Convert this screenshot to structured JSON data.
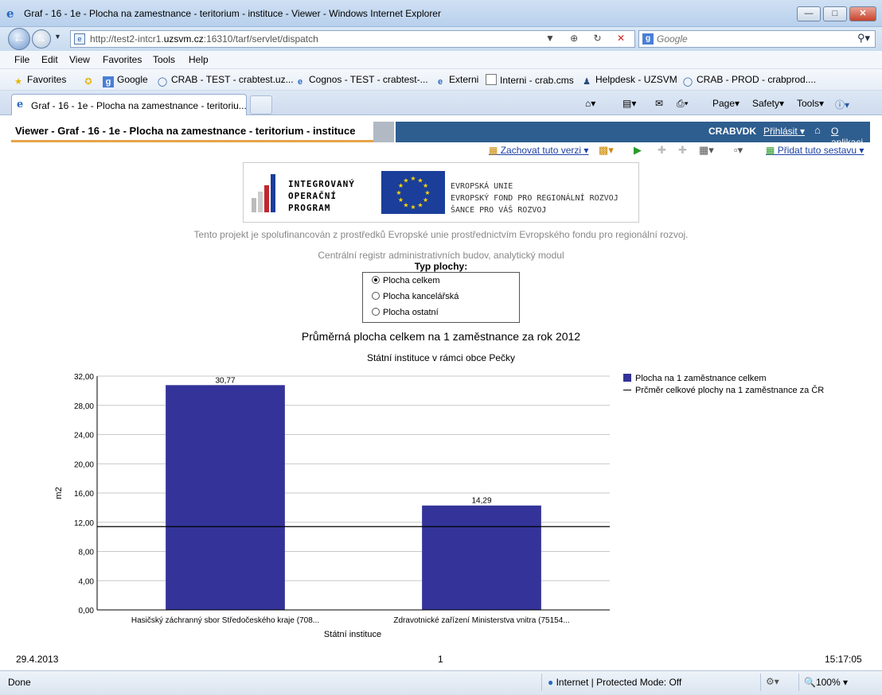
{
  "window": {
    "title": "Graf - 16 - 1e - Plocha na zamestnance - teritorium - instituce - Viewer - Windows Internet Explorer",
    "minimize": "—",
    "maximize": "□",
    "close": "✕"
  },
  "address": {
    "url_prefix": "http://test2-intcr1.",
    "url_host": "uzsvm.cz",
    "url_rest": ":16310/tarf/servlet/dispatch",
    "search_placeholder": "Google"
  },
  "menu": [
    "File",
    "Edit",
    "View",
    "Favorites",
    "Tools",
    "Help"
  ],
  "favorites": {
    "label": "Favorites",
    "items": [
      {
        "label": "Google",
        "icon": "google-icon"
      },
      {
        "label": "CRAB - TEST - crabtest.uz...",
        "icon": "crab-icon"
      },
      {
        "label": "Cognos - TEST - crabtest-...",
        "icon": "ie-page-icon"
      },
      {
        "label": "Externi",
        "icon": "ie-page-icon"
      },
      {
        "label": "Interni - crab.cms",
        "icon": "page-icon"
      },
      {
        "label": "Helpdesk - UZSVM",
        "icon": "people-icon"
      },
      {
        "label": "CRAB - PROD - crabprod....",
        "icon": "crab-icon"
      }
    ]
  },
  "tab": {
    "title": "Graf - 16 - 1e - Plocha na zamestnance - teritoriu...",
    "commands": {
      "page": "Page",
      "safety": "Safety",
      "tools": "Tools"
    }
  },
  "viewer": {
    "title": "Viewer - Graf - 16 - 1e - Plocha na zamestnance - teritorium - instituce",
    "user": "CRABVDK",
    "login": "Přihlásit",
    "about": "O aplikaci",
    "save_version": "Zachovat tuto verzi",
    "add_report": "Přidat tuto sestavu"
  },
  "banner": {
    "iop_lines": [
      "INTEGROVANÝ",
      "OPERAČNÍ",
      "PROGRAM"
    ],
    "eu_lines": [
      "EVROPSKÁ UNIE",
      "EVROPSKÝ FOND PRO REGIONÁLNÍ ROZVOJ",
      "ŠANCE PRO VÁŠ ROZVOJ"
    ]
  },
  "captions": {
    "cofinanced": "Tento projekt je spolufinancován z prostředků Evropské unie prostřednictvím Evropského fondu pro regionální rozvoj.",
    "module": "Centrální registr administrativních budov, analytický modul"
  },
  "filter": {
    "label": "Typ plochy:",
    "options": [
      {
        "label": "Plocha celkem",
        "selected": true
      },
      {
        "label": "Plocha kancelářská",
        "selected": false
      },
      {
        "label": "Plocha ostatní",
        "selected": false
      }
    ]
  },
  "chart_data": {
    "type": "bar",
    "title": "Průměrná plocha celkem na 1 zaměstnance za rok 2012",
    "subtitle": "Státní instituce v rámci obce Pečky",
    "xlabel": "Státní instituce",
    "ylabel": "m2",
    "ylim": [
      0,
      32
    ],
    "yticks": [
      "0,00",
      "4,00",
      "8,00",
      "12,00",
      "16,00",
      "20,00",
      "24,00",
      "28,00",
      "32,00"
    ],
    "ytick_values": [
      0,
      4,
      8,
      12,
      16,
      20,
      24,
      28,
      32
    ],
    "categories": [
      "Hasičský záchranný sbor Středočeského kraje (708...",
      "Zdravotnické zařízení Ministerstva vnitra (75154..."
    ],
    "series": [
      {
        "name": "Plocha na 1 zaměstnance celkem",
        "values": [
          30.77,
          14.29
        ],
        "labels": [
          "30,77",
          "14,29"
        ],
        "color": "#333399"
      }
    ],
    "reference_line": {
      "name": "Prčměr celkové plochy na 1 zaměstnance za ČR",
      "value": 11.4
    },
    "grid": true,
    "legend": "right"
  },
  "footer": {
    "date": "29.4.2013",
    "page": "1",
    "time": "15:17:05"
  },
  "status": {
    "text": "Done",
    "zone": "Internet | Protected Mode: Off",
    "zoom": "100%"
  }
}
